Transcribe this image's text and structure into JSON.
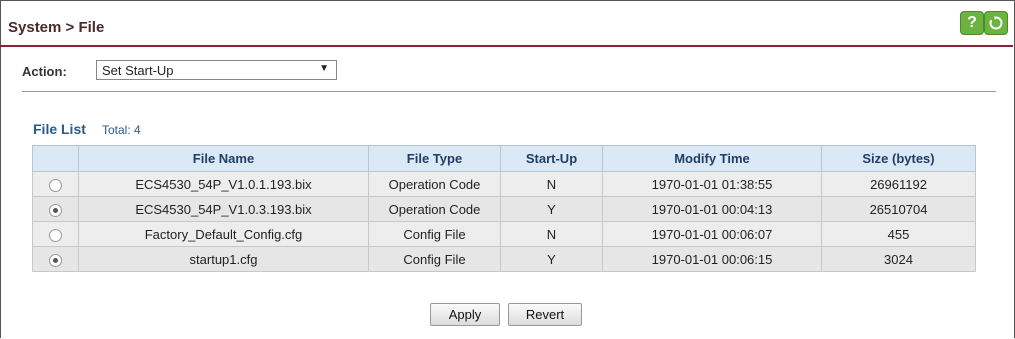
{
  "header": {
    "title": "System > File",
    "help_icon": "help-icon",
    "refresh_icon": "refresh-icon",
    "help_glyph": "?",
    "accent_color": "#8c2332",
    "icon_color": "#6cb33f"
  },
  "action": {
    "label": "Action:",
    "selected": "Set Start-Up",
    "arrow": "▼"
  },
  "file_list": {
    "title": "File List",
    "total": "Total: 4",
    "columns": [
      "",
      "File Name",
      "File Type",
      "Start-Up",
      "Modify Time",
      "Size (bytes)"
    ],
    "rows": [
      {
        "selected": false,
        "name": "ECS4530_54P_V1.0.1.193.bix",
        "type": "Operation Code",
        "startup": "N",
        "modified": "1970-01-01 01:38:55",
        "size": "26961192"
      },
      {
        "selected": true,
        "name": "ECS4530_54P_V1.0.3.193.bix",
        "type": "Operation Code",
        "startup": "Y",
        "modified": "1970-01-01 00:04:13",
        "size": "26510704"
      },
      {
        "selected": false,
        "name": "Factory_Default_Config.cfg",
        "type": "Config File",
        "startup": "N",
        "modified": "1970-01-01 00:06:07",
        "size": "455"
      },
      {
        "selected": true,
        "name": "startup1.cfg",
        "type": "Config File",
        "startup": "Y",
        "modified": "1970-01-01 00:06:15",
        "size": "3024"
      }
    ]
  },
  "buttons": {
    "apply": "Apply",
    "revert": "Revert"
  }
}
